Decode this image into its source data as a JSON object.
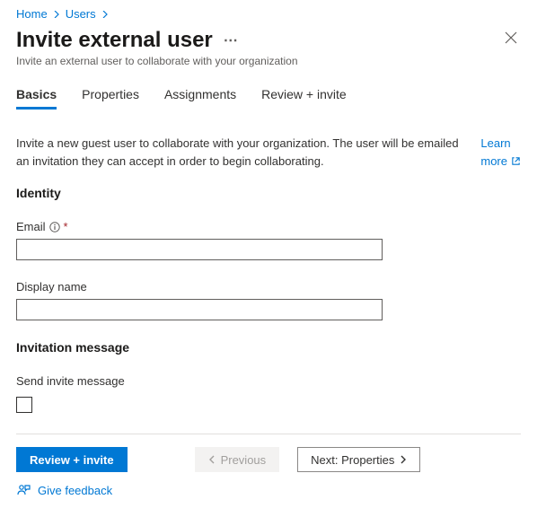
{
  "breadcrumb": {
    "items": [
      "Home",
      "Users"
    ]
  },
  "header": {
    "title": "Invite external user",
    "subtitle": "Invite an external user to collaborate with your organization"
  },
  "tabs": [
    {
      "label": "Basics",
      "active": true
    },
    {
      "label": "Properties",
      "active": false
    },
    {
      "label": "Assignments",
      "active": false
    },
    {
      "label": "Review + invite",
      "active": false
    }
  ],
  "main": {
    "description": "Invite a new guest user to collaborate with your organization. The user will be emailed an invitation they can accept in order to begin collaborating.",
    "learn_more_top": "Learn",
    "learn_more_bottom": "more"
  },
  "form": {
    "identity_heading": "Identity",
    "email_label": "Email",
    "email_required": "*",
    "email_value": "",
    "display_name_label": "Display name",
    "display_name_value": "",
    "invitation_heading": "Invitation message",
    "send_invite_label": "Send invite message",
    "send_invite_checked": false
  },
  "footer": {
    "primary": "Review + invite",
    "previous": "Previous",
    "next": "Next: Properties",
    "feedback": "Give feedback"
  }
}
